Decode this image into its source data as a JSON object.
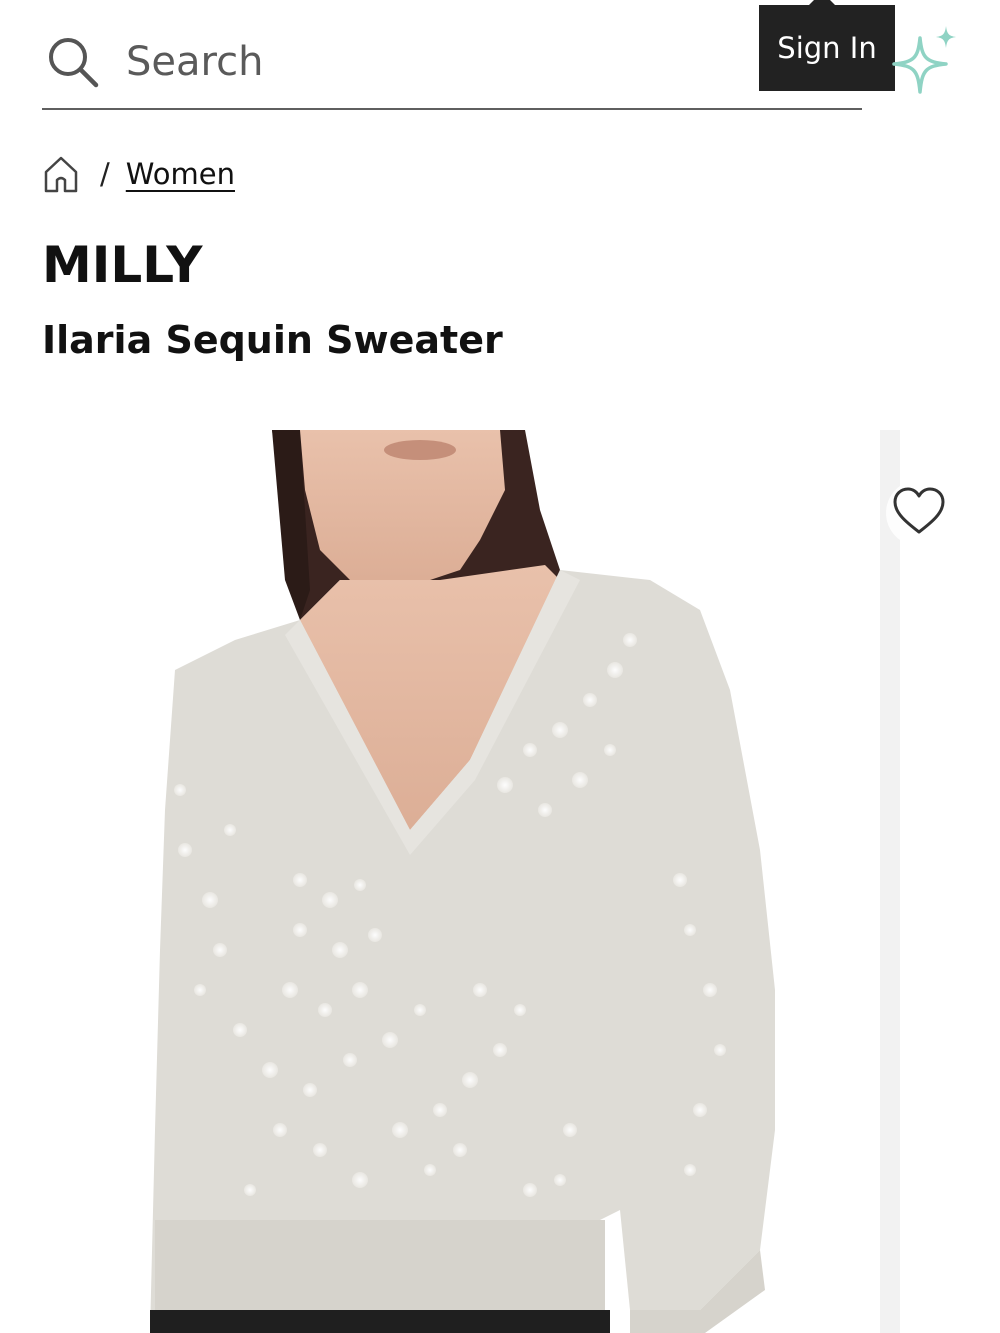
{
  "search": {
    "placeholder": "Search"
  },
  "header": {
    "sign_in_label": "Sign In"
  },
  "breadcrumb": {
    "items": [
      "Women"
    ],
    "separator": "/"
  },
  "product": {
    "brand": "MILLY",
    "name": "Ilaria Sequin Sweater"
  },
  "icons": {
    "search": "search-icon",
    "home": "home-icon",
    "sparkle": "sparkle-icon",
    "wishlist": "heart-icon"
  },
  "colors": {
    "sign_in_bg": "#222222",
    "sparkle": "#8fd3c4",
    "text": "#111111",
    "divider": "#5f5f5f"
  }
}
